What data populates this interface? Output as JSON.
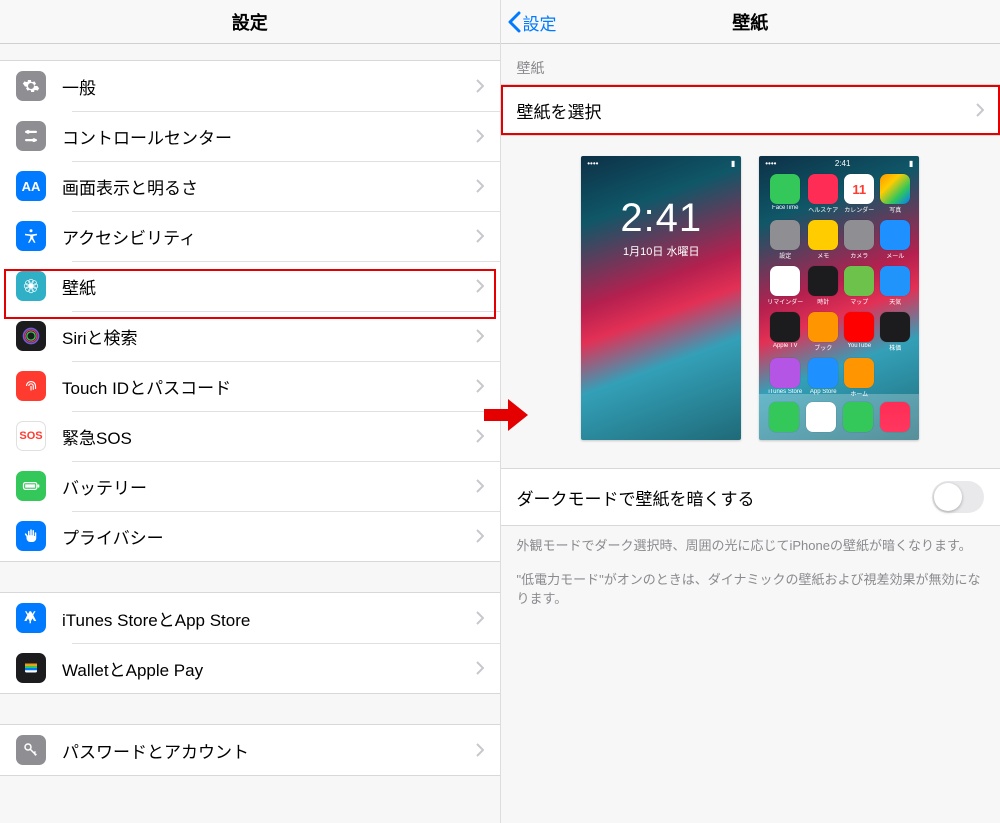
{
  "left": {
    "title": "設定",
    "groups": [
      {
        "items": [
          {
            "id": "general",
            "label": "一般"
          },
          {
            "id": "control-center",
            "label": "コントロールセンター"
          },
          {
            "id": "display",
            "label": "画面表示と明るさ"
          },
          {
            "id": "accessibility",
            "label": "アクセシビリティ"
          },
          {
            "id": "wallpaper",
            "label": "壁紙"
          },
          {
            "id": "siri",
            "label": "Siriと検索"
          },
          {
            "id": "touchid",
            "label": "Touch IDとパスコード"
          },
          {
            "id": "sos",
            "label": "緊急SOS"
          },
          {
            "id": "battery",
            "label": "バッテリー"
          },
          {
            "id": "privacy",
            "label": "プライバシー"
          }
        ]
      },
      {
        "items": [
          {
            "id": "itunes",
            "label": "iTunes StoreとApp Store"
          },
          {
            "id": "wallet",
            "label": "WalletとApple Pay"
          }
        ]
      },
      {
        "items": [
          {
            "id": "passwords",
            "label": "パスワードとアカウント"
          }
        ]
      }
    ]
  },
  "right": {
    "back": "設定",
    "title": "壁紙",
    "section_header": "壁紙",
    "choose": "壁紙を選択",
    "lock_time": "2:41",
    "lock_date": "1月10日 水曜日",
    "home_apps": [
      "FaceTime",
      "ヘルスケア",
      "カレンダー",
      "写真",
      "設定",
      "メモ",
      "カメラ",
      "メール",
      "リマインダー",
      "時計",
      "マップ",
      "天気",
      "Apple TV",
      "ブック",
      "YouTube",
      "株価",
      "iTunes Store",
      "App Store",
      "ホーム",
      ""
    ],
    "dock_apps": [
      "電話",
      "Safari",
      "メッセージ",
      "ミュージック"
    ],
    "calendar_day": "11",
    "toggle_label": "ダークモードで壁紙を暗くする",
    "desc1": "外観モードでダーク選択時、周囲の光に応じてiPhoneの壁紙が暗くなります。",
    "desc2": "\"低電力モード\"がオンのときは、ダイナミックの壁紙および視差効果が無効になります。"
  }
}
